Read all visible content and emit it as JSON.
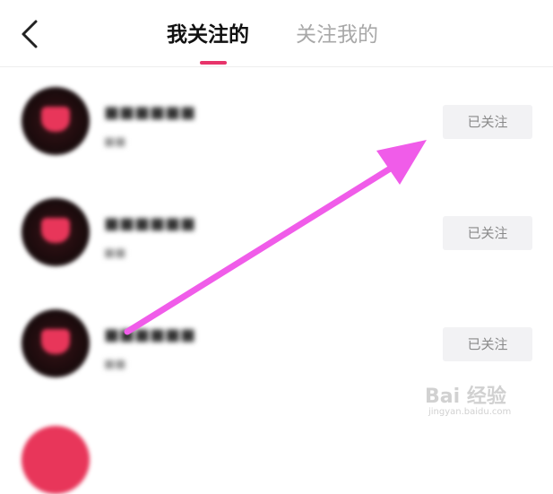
{
  "header": {
    "tabs": [
      {
        "label": "我关注的",
        "active": true
      },
      {
        "label": "关注我的",
        "active": false
      }
    ],
    "back_icon": "chevron-left-icon",
    "indicator_color": "#e7336a"
  },
  "list": {
    "items": [
      {
        "button_label": "已关注"
      },
      {
        "button_label": "已关注"
      },
      {
        "button_label": "已关注"
      }
    ]
  },
  "annotation": {
    "arrow_color": "#f05ce9",
    "arrow_icon": "pink-arrow-annotation"
  },
  "watermark": {
    "main": "Bai 经验",
    "url": "jingyan.baidu.com"
  }
}
